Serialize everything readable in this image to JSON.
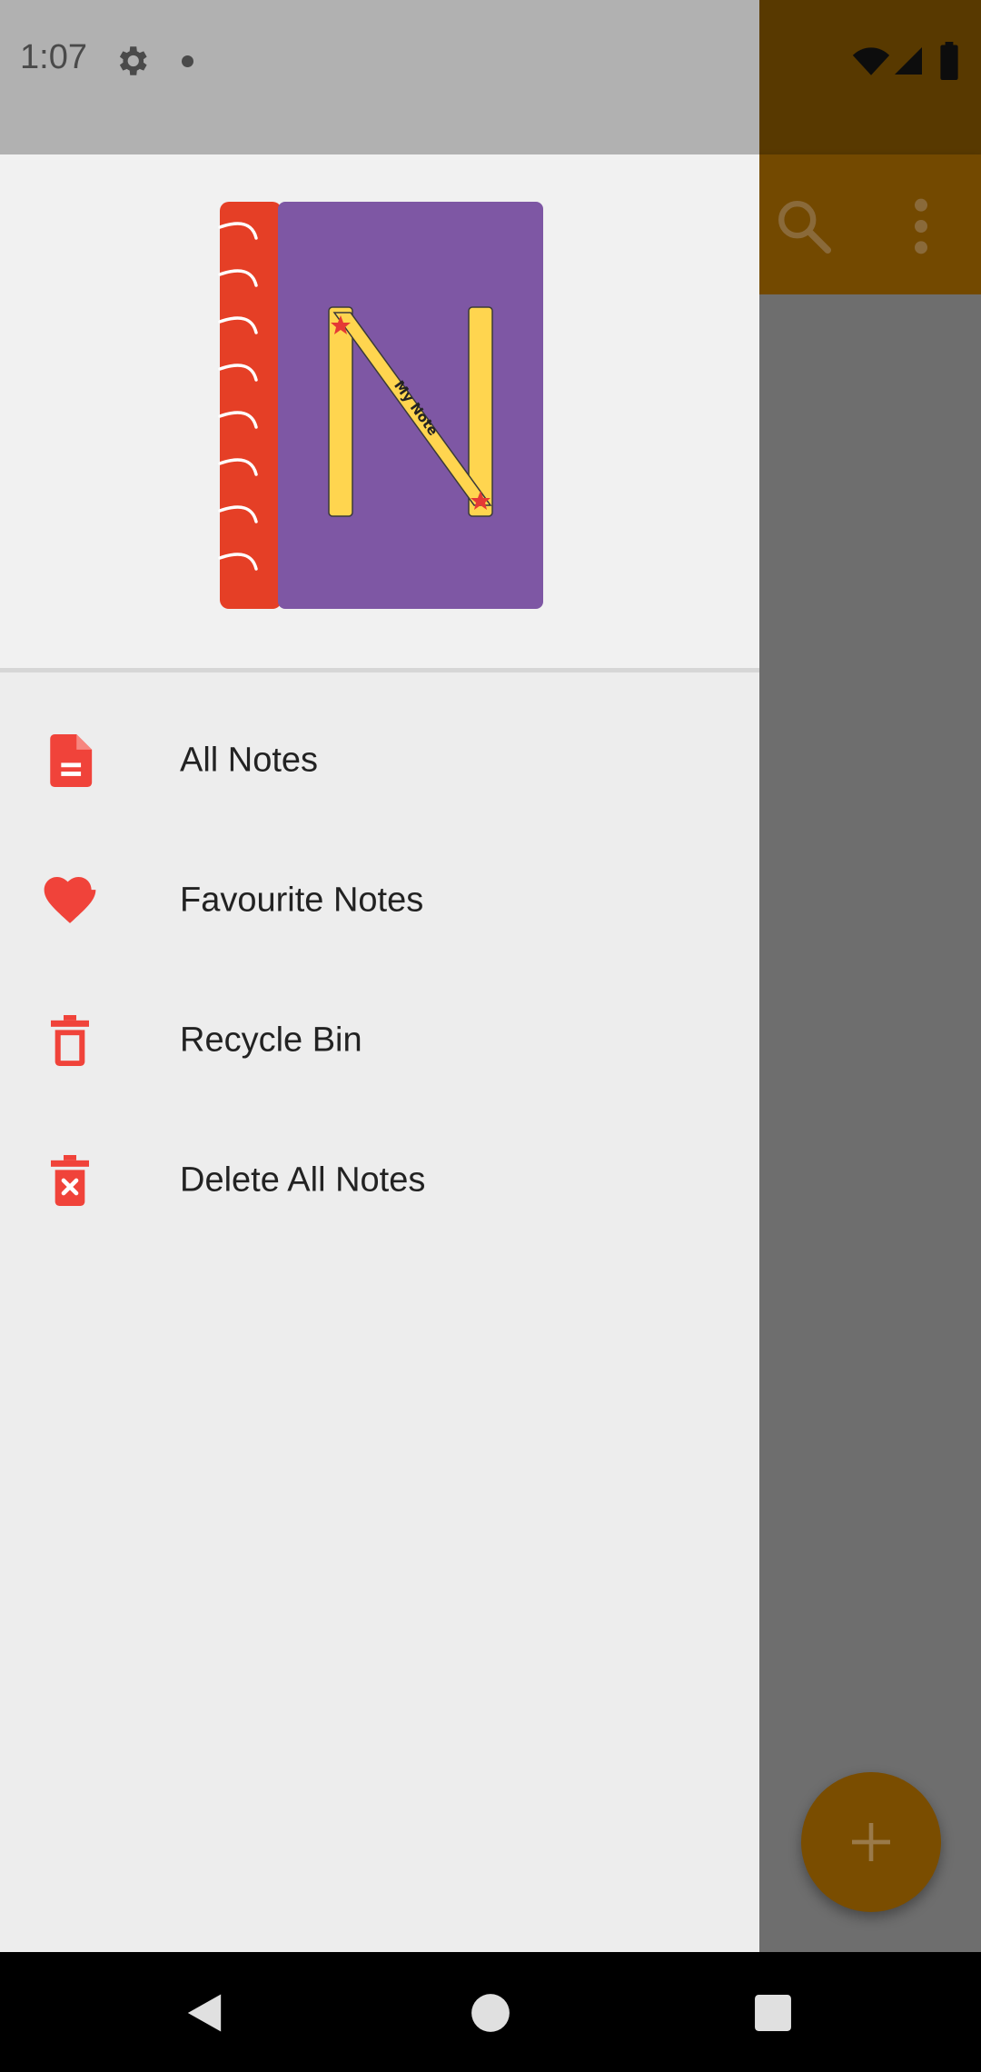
{
  "status_bar": {
    "time": "1:07"
  },
  "drawer": {
    "logo_caption": "My Note",
    "menu": [
      {
        "label": "All Notes",
        "icon": "document-icon"
      },
      {
        "label": "Favourite Notes",
        "icon": "heart-icon"
      },
      {
        "label": "Recycle Bin",
        "icon": "trash-icon"
      },
      {
        "label": "Delete All Notes",
        "icon": "delete-all-icon"
      }
    ]
  },
  "colors": {
    "accent": "#f0433a",
    "notebook_cover": "#7e57a4",
    "notebook_spine": "#e53f26",
    "toolbar_dimmed": "#734900"
  }
}
